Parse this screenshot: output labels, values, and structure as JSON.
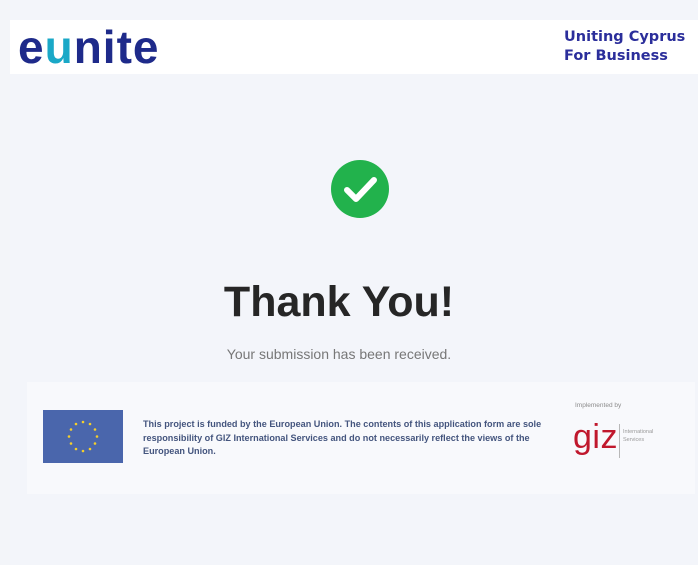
{
  "header": {
    "logo_prefix": "e",
    "logo_u": "u",
    "logo_suffix": "nite",
    "tagline_line1": "Uniting Cyprus",
    "tagline_line2": "For Business"
  },
  "confirmation": {
    "icon": "check-circle-icon",
    "icon_color": "#22b24c",
    "title": "Thank You!",
    "message": "Your submission has been received."
  },
  "footer": {
    "notice": "This project is funded by the European Union. The contents of this application form are sole responsibility of GIZ International Services and do not necessarily reflect the views of the European Union.",
    "implemented_by": "Implemented by",
    "giz_logo": "giz",
    "giz_line1": "International",
    "giz_line2": "Services",
    "eu_flag_color": "#4a66ac",
    "eu_star_color": "#f5cf2b"
  },
  "colors": {
    "brand_dark_blue": "#1e2a8a",
    "brand_teal": "#1aa8c7",
    "giz_red": "#c0182d"
  }
}
